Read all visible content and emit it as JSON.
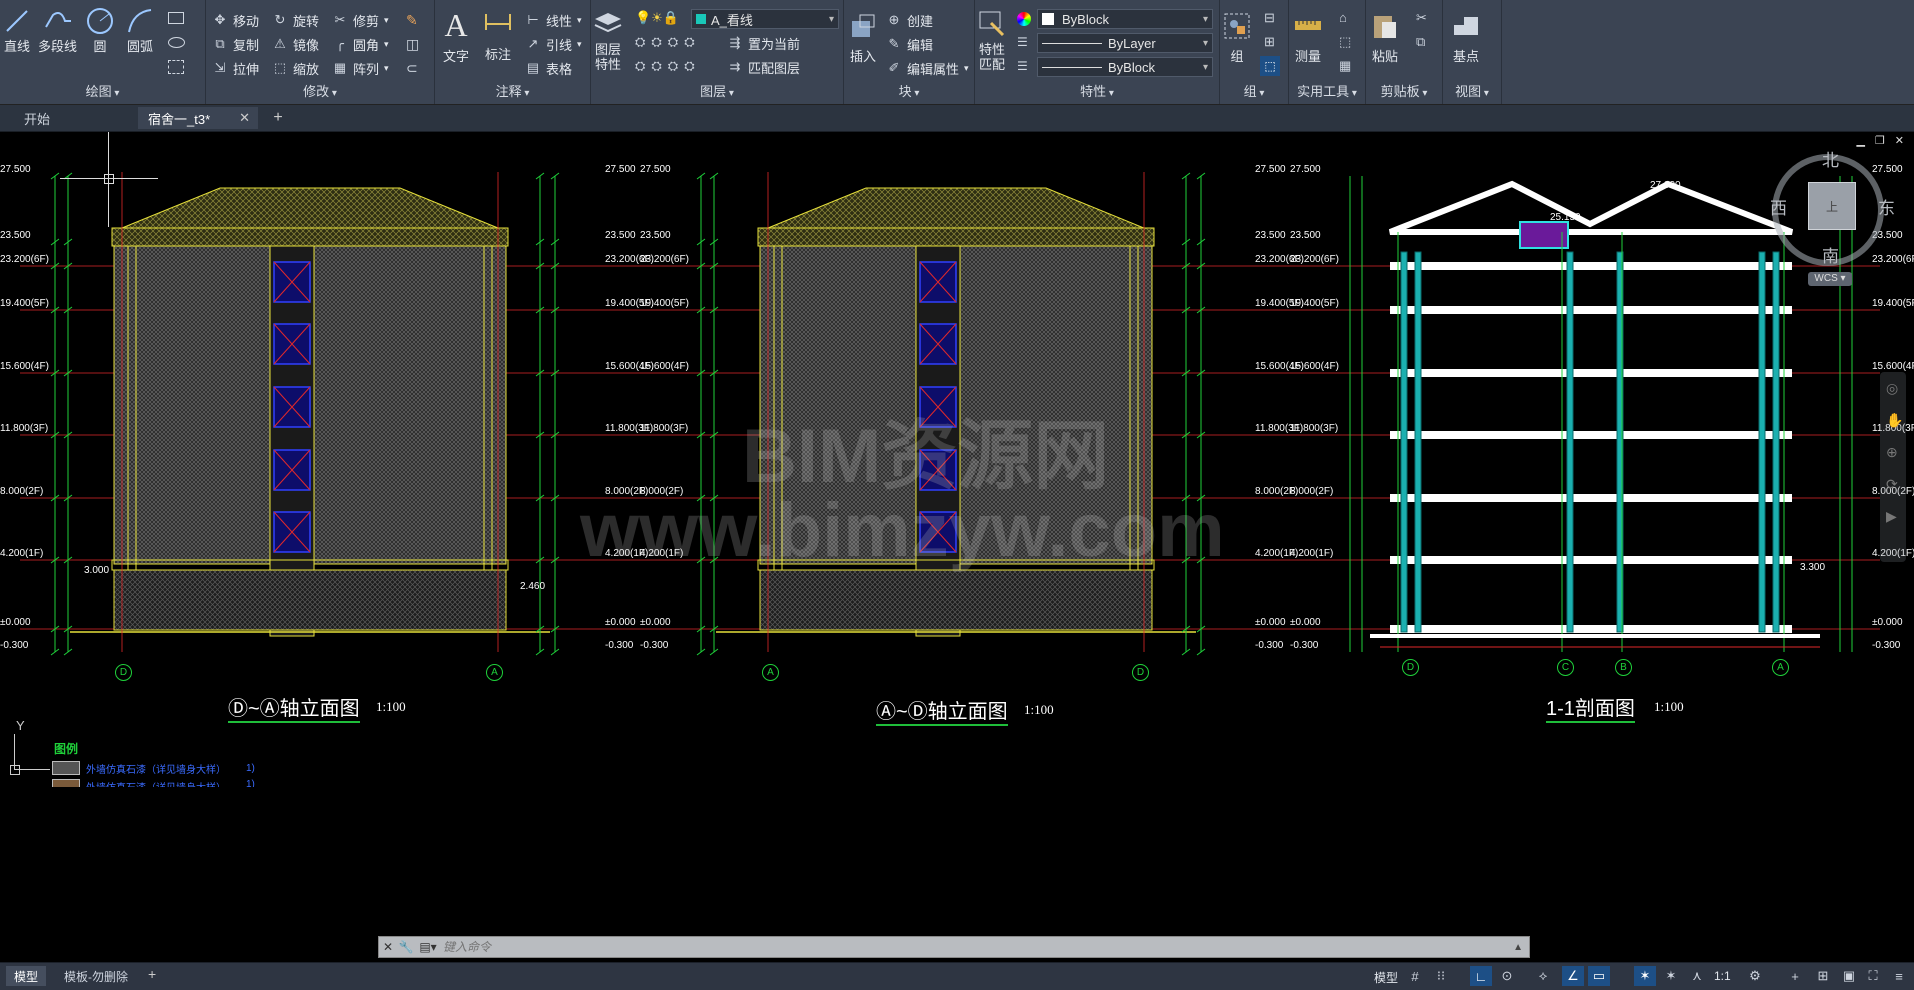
{
  "ribbon": {
    "draw": {
      "title": "绘图",
      "line": "直线",
      "polyline": "多段线",
      "circle": "圆",
      "arc": "圆弧"
    },
    "modify": {
      "title": "修改",
      "move": "移动",
      "rotate": "旋转",
      "trim": "修剪",
      "copy": "复制",
      "mirror": "镜像",
      "fillet": "圆角",
      "stretch": "拉伸",
      "scale": "缩放",
      "array": "阵列"
    },
    "annotation": {
      "title": "注释",
      "text": "文字",
      "dimension": "标注",
      "linear": "线性",
      "leader": "引线",
      "table": "表格"
    },
    "layers": {
      "title": "图层",
      "layer_props": "图层\n特性",
      "current_layer": "A_看线",
      "set_current": "置为当前",
      "match_layer": "匹配图层"
    },
    "block": {
      "title": "块",
      "insert": "插入",
      "create": "创建",
      "edit": "编辑",
      "edit_attr": "编辑属性"
    },
    "properties": {
      "title": "特性",
      "match": "特性\n匹配",
      "color": "ByBlock",
      "linetype": "ByLayer",
      "lineweight": "ByBlock"
    },
    "groups": {
      "title": "组",
      "group": "组"
    },
    "utilities": {
      "title": "实用工具",
      "measure": "测量"
    },
    "clipboard": {
      "title": "剪贴板",
      "paste": "粘贴"
    },
    "view": {
      "title": "视图",
      "base": "基点"
    }
  },
  "tabs": [
    {
      "label": "开始"
    },
    {
      "label": "宿舍一_t3*"
    }
  ],
  "navcube": {
    "north": "北",
    "south": "南",
    "east": "东",
    "west": "西",
    "wcs": "WCS"
  },
  "drawing": {
    "titles": [
      "Ⓓ~Ⓐ轴立面图",
      "Ⓐ~Ⓓ轴立面图",
      "1-1剖面图"
    ],
    "scale": "1:100",
    "elevations": [
      "27.500",
      "23.500",
      "23.200(6F)",
      "19.400(5F)",
      "15.600(4F)",
      "11.800(3F)",
      "8.000(2F)",
      "4.200(1F)",
      "±0.000",
      "-0.300"
    ],
    "extra_elevations": [
      "3.000",
      "2.460",
      "25.150",
      "27.000",
      "3.300"
    ],
    "axis_labels": [
      "D",
      "A",
      "A",
      "D",
      "D",
      "C",
      "B",
      "A"
    ],
    "legend_title": "图例",
    "legend_items": [
      "外墙仿真石漆（详见墙身大样）",
      "外墙仿真石漆（详见墙身大样）"
    ],
    "legend_values": [
      "1)",
      "1)"
    ],
    "ucs_y": "Y"
  },
  "watermark": {
    "line1": "BIM资源网",
    "line2": "www.bimzyw.com"
  },
  "command": {
    "placeholder": "键入命令"
  },
  "layout_tabs": [
    {
      "label": "模型"
    },
    {
      "label": "模板-勿删除"
    }
  ],
  "statusbar": {
    "model": "模型",
    "scale": "1:1"
  }
}
